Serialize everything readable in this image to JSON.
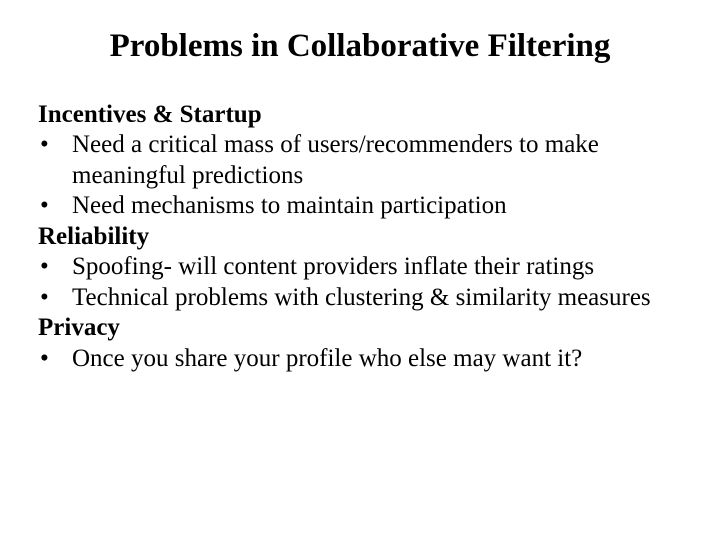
{
  "title": "Problems in Collaborative Filtering",
  "sections": [
    {
      "heading": "Incentives & Startup",
      "bullets": [
        "Need a critical mass of users/recommenders to make meaningful predictions",
        "Need mechanisms to maintain participation"
      ]
    },
    {
      "heading": "Reliability",
      "bullets": [
        "Spoofing- will content providers inflate their ratings",
        "Technical problems with clustering & similarity measures"
      ]
    },
    {
      "heading": "Privacy",
      "bullets": [
        "Once you share your profile who else may want it?"
      ]
    }
  ],
  "bullet_char": "•"
}
